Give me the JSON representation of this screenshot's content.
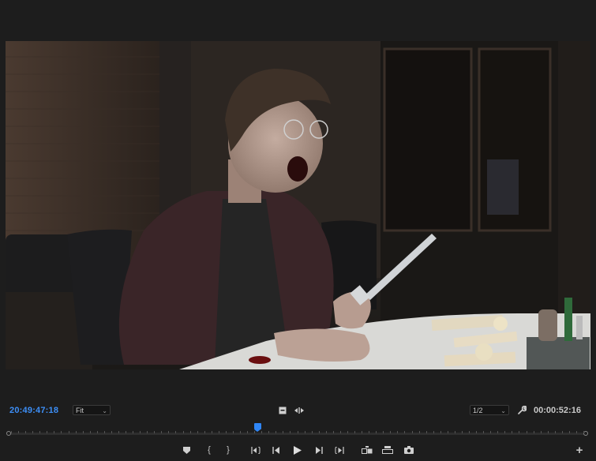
{
  "monitor": {
    "timecode_current": "20:49:47:18",
    "zoom_select": "Fit",
    "resolution_select": "1/2",
    "timecode_duration": "00:00:52:16"
  },
  "icons": {
    "safe_margins": "safe-margins-icon",
    "toggle_proxies": "toggle-proxies-icon",
    "settings": "wrench-icon",
    "add_button": "plus-icon",
    "marker": "add-marker-icon",
    "mark_in": "mark-in-icon",
    "mark_out": "mark-out-icon",
    "go_to_in": "go-to-in-icon",
    "step_back": "step-back-icon",
    "play": "play-icon",
    "step_forward": "step-forward-icon",
    "go_to_out": "go-to-out-icon",
    "insert": "insert-icon",
    "overwrite": "overwrite-icon",
    "export_frame": "camera-icon"
  },
  "colors": {
    "accent": "#3d8ff7",
    "background": "#1d1d1d"
  },
  "playhead": {
    "position_fraction": 0.43
  }
}
